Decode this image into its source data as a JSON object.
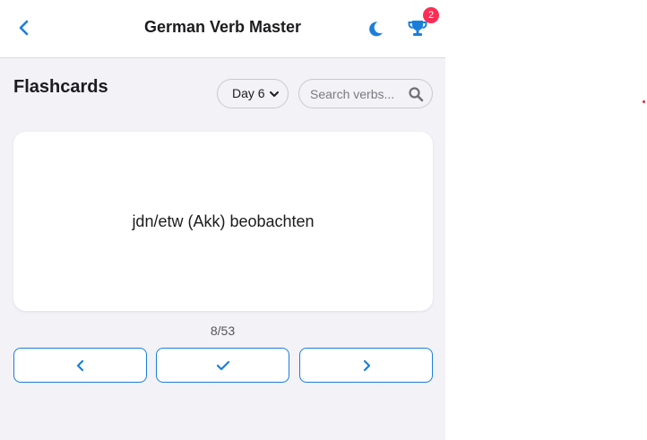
{
  "header": {
    "title": "German Verb Master",
    "badge_count": "2",
    "back_icon": "chevron-left-icon",
    "theme_icon": "moon-icon",
    "achievements_icon": "trophy-icon"
  },
  "section": {
    "title": "Flashcards"
  },
  "filters": {
    "day_select": {
      "selected": "Day 6"
    },
    "search": {
      "placeholder": "Search verbs...",
      "value": ""
    }
  },
  "card": {
    "text": "jdn/etw (Akk) beobachten"
  },
  "progress": {
    "label": "8/53",
    "current": 8,
    "total": 53
  },
  "controls": {
    "prev_icon": "chevron-left-icon",
    "check_icon": "checkmark-icon",
    "next_icon": "chevron-right-icon"
  },
  "colors": {
    "accent": "#1a7fdb",
    "badge": "#ff2d55",
    "background": "#f2f2f7",
    "card": "#ffffff"
  }
}
